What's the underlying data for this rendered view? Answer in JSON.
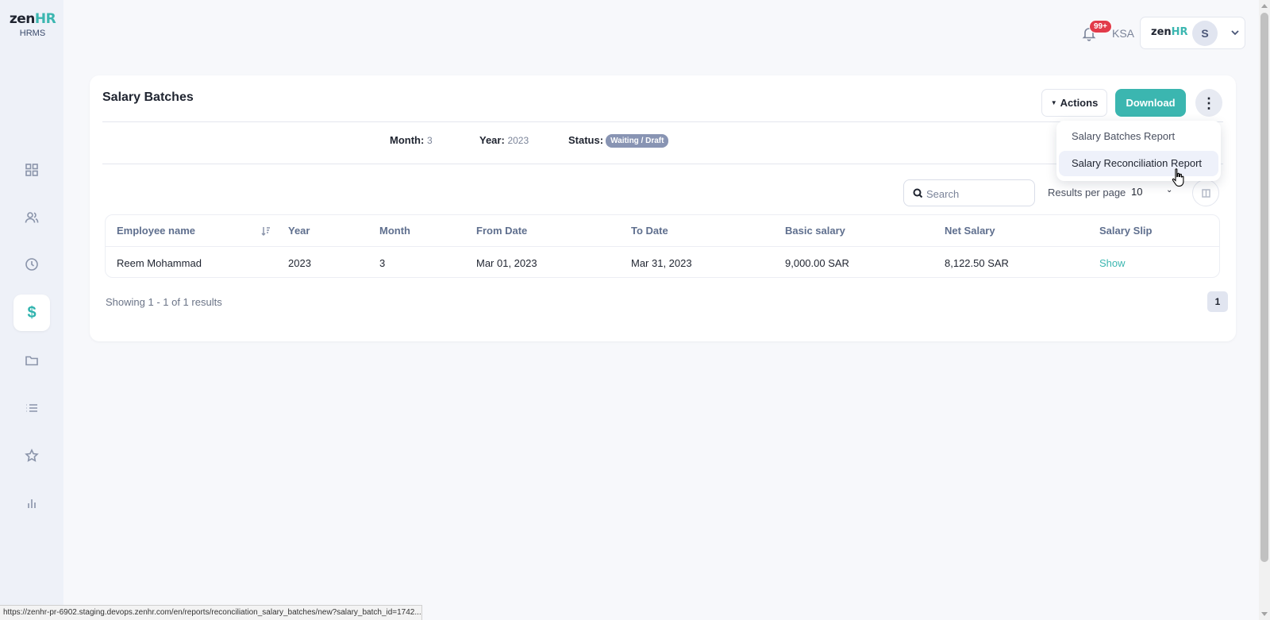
{
  "app": {
    "logo_brand_main": "zen",
    "logo_brand_accent": "HR",
    "logo_sub": "HRMS"
  },
  "sidebar": {
    "items": [
      {
        "name": "dashboard",
        "icon": "grid-icon",
        "active": false
      },
      {
        "name": "employees",
        "icon": "users-icon",
        "active": false
      },
      {
        "name": "attendance",
        "icon": "clock-icon",
        "active": false
      },
      {
        "name": "payroll",
        "icon": "dollar-icon",
        "active": true,
        "glyph": "$"
      },
      {
        "name": "documents",
        "icon": "folder-icon",
        "active": false
      },
      {
        "name": "lists",
        "icon": "list-icon",
        "active": false
      },
      {
        "name": "favorites",
        "icon": "star-icon",
        "active": false
      },
      {
        "name": "reports",
        "icon": "bar-chart-icon",
        "active": false
      }
    ]
  },
  "topbar": {
    "notification_count": "99+",
    "country": "KSA",
    "org_main": "zen",
    "org_accent": "HR",
    "avatar_initial": "S"
  },
  "card": {
    "title": "Salary Batches",
    "actions_label": "Actions",
    "download_label": "Download",
    "meta": {
      "month_label": "Month:",
      "month_value": "3",
      "year_label": "Year:",
      "year_value": "2023",
      "status_label": "Status:",
      "status_value": "Waiting / Draft"
    },
    "search_placeholder": "Search",
    "results_per_page_label": "Results per page",
    "results_per_page_value": "10",
    "table": {
      "columns": [
        "Employee name",
        "Year",
        "Month",
        "From Date",
        "To Date",
        "Basic salary",
        "Net Salary",
        "Salary Slip"
      ],
      "rows": [
        {
          "employee_name": "Reem Mohammad",
          "year": "2023",
          "month": "3",
          "from_date": "Mar 01, 2023",
          "to_date": "Mar 31, 2023",
          "basic_salary": "9,000.00 SAR",
          "net_salary": "8,122.50 SAR",
          "salary_slip": "Show"
        }
      ]
    },
    "showing_text": "Showing 1 - 1 of 1 results",
    "current_page": "1"
  },
  "dropdown": {
    "items": [
      {
        "label": "Salary Batches Report"
      },
      {
        "label": "Salary Reconciliation Report"
      }
    ]
  },
  "statusbar": {
    "url": "https://zenhr-pr-6902.staging.devops.zenhr.com/en/reports/reconciliation_salary_batches/new?salary_batch_id=1742..."
  },
  "colors": {
    "accent": "#3bb6b0",
    "badge": "#e23b4a",
    "status_pill": "#8894b3"
  }
}
